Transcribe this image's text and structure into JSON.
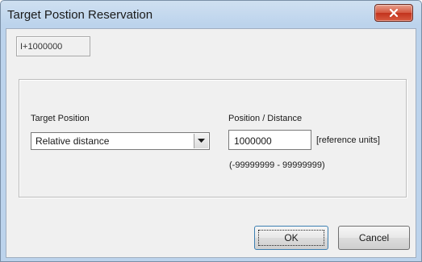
{
  "window": {
    "title": "Target Postion Reservation",
    "close_icon": "close-icon"
  },
  "readout": {
    "value": "I+1000000"
  },
  "target_position": {
    "label": "Target Position",
    "selected": "Relative distance"
  },
  "position_distance": {
    "label": "Position / Distance",
    "value": "1000000",
    "unit": "[reference units]",
    "range": "(-99999999 - 99999999)"
  },
  "buttons": {
    "ok": "OK",
    "cancel": "Cancel"
  }
}
